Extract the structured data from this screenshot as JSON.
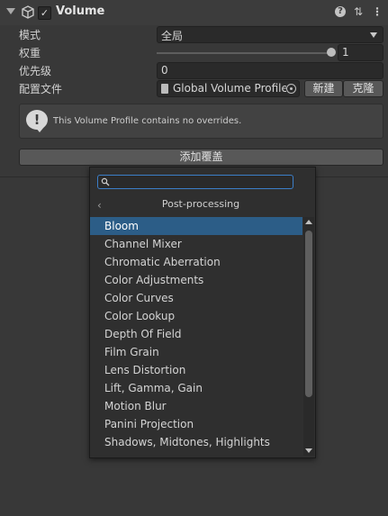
{
  "component": {
    "title": "Volume",
    "enabled": true
  },
  "properties": {
    "mode_label": "模式",
    "mode_value": "全局",
    "weight_label": "权重",
    "weight_value": "1",
    "weight_fraction": 1.0,
    "priority_label": "优先级",
    "priority_value": "0",
    "profile_label": "配置文件",
    "profile_value": "Global Volume Profile",
    "new_button": "新建",
    "clone_button": "克隆"
  },
  "help_box": {
    "icon": "!",
    "text": "This Volume Profile contains no overrides."
  },
  "add_override_button": "添加覆盖",
  "popup": {
    "search_value": "",
    "back_glyph": "‹",
    "breadcrumb": "Post-processing",
    "items": [
      {
        "label": "Bloom",
        "selected": true
      },
      {
        "label": "Channel Mixer"
      },
      {
        "label": "Chromatic Aberration"
      },
      {
        "label": "Color Adjustments"
      },
      {
        "label": "Color Curves"
      },
      {
        "label": "Color Lookup"
      },
      {
        "label": "Depth Of Field"
      },
      {
        "label": "Film Grain"
      },
      {
        "label": "Lens Distortion"
      },
      {
        "label": "Lift, Gamma, Gain"
      },
      {
        "label": "Motion Blur"
      },
      {
        "label": "Panini Projection"
      },
      {
        "label": "Shadows, Midtones, Highlights"
      }
    ]
  },
  "colors": {
    "background": "#383838",
    "selection": "#2c5d87",
    "search_focus": "#3c7ec8"
  }
}
